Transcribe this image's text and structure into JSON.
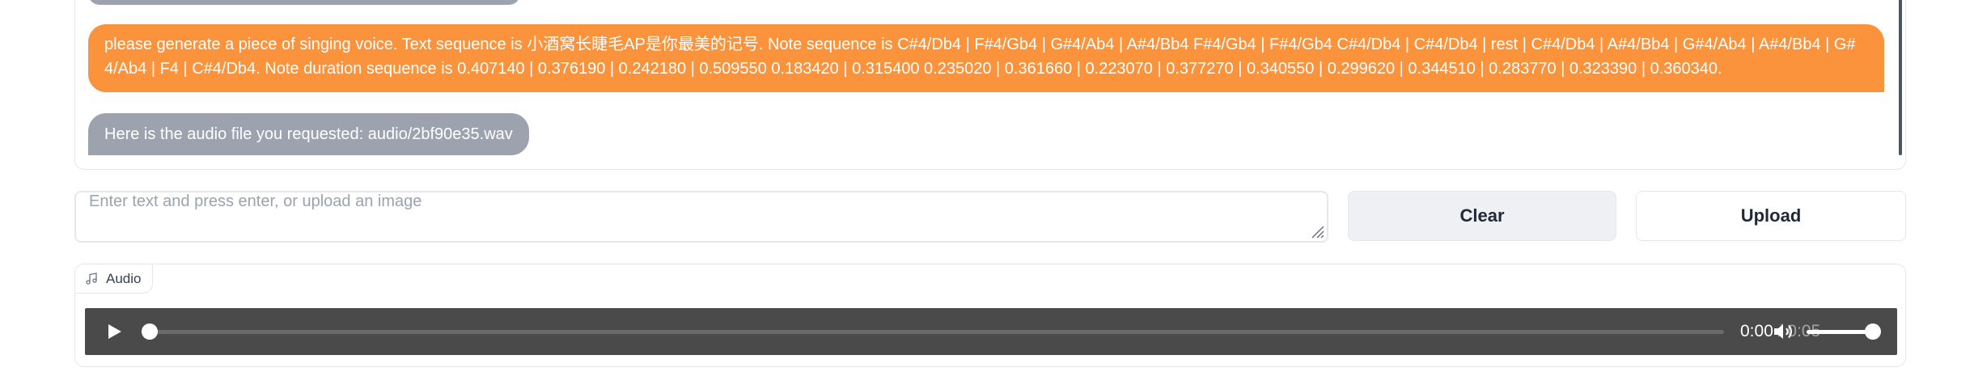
{
  "chat": {
    "messages": [
      {
        "role": "user",
        "text": "please generate a piece of singing voice. Text sequence is 小酒窝长睫毛AP是你最美的记号. Note sequence is C#4/Db4 | F#4/Gb4 | G#4/Ab4 | A#4/Bb4 F#4/Gb4 | F#4/Gb4 C#4/Db4 | C#4/Db4 | rest | C#4/Db4 | A#4/Bb4 | G#4/Ab4 | A#4/Bb4 | G#4/Ab4 | F4 | C#4/Db4. Note duration sequence is 0.407140 | 0.376190 | 0.242180 | 0.509550 0.183420 | 0.315400 0.235020 | 0.361660 | 0.223070 | 0.377270 | 0.340550 | 0.299620 | 0.344510 | 0.283770 | 0.323390 | 0.360340."
      },
      {
        "role": "bot",
        "text": "Here is the audio file you requested: audio/2bf90e35.wav"
      }
    ]
  },
  "input": {
    "placeholder": "Enter text and press enter, or upload an image",
    "value": ""
  },
  "buttons": {
    "clear_label": "Clear",
    "upload_label": "Upload"
  },
  "audio": {
    "label": "Audio",
    "current_time": "0:00",
    "separator": "/",
    "duration": "0:05",
    "progress": 0,
    "volume": 1.0
  },
  "colors": {
    "user_bubble": "#fb923c",
    "bot_bubble": "#9ca3af",
    "player_bg": "#4a4a4a"
  },
  "icons": {
    "audio_label": "music-note-icon",
    "play": "play-icon",
    "volume": "speaker-icon",
    "resize": "resize-grip-icon"
  }
}
